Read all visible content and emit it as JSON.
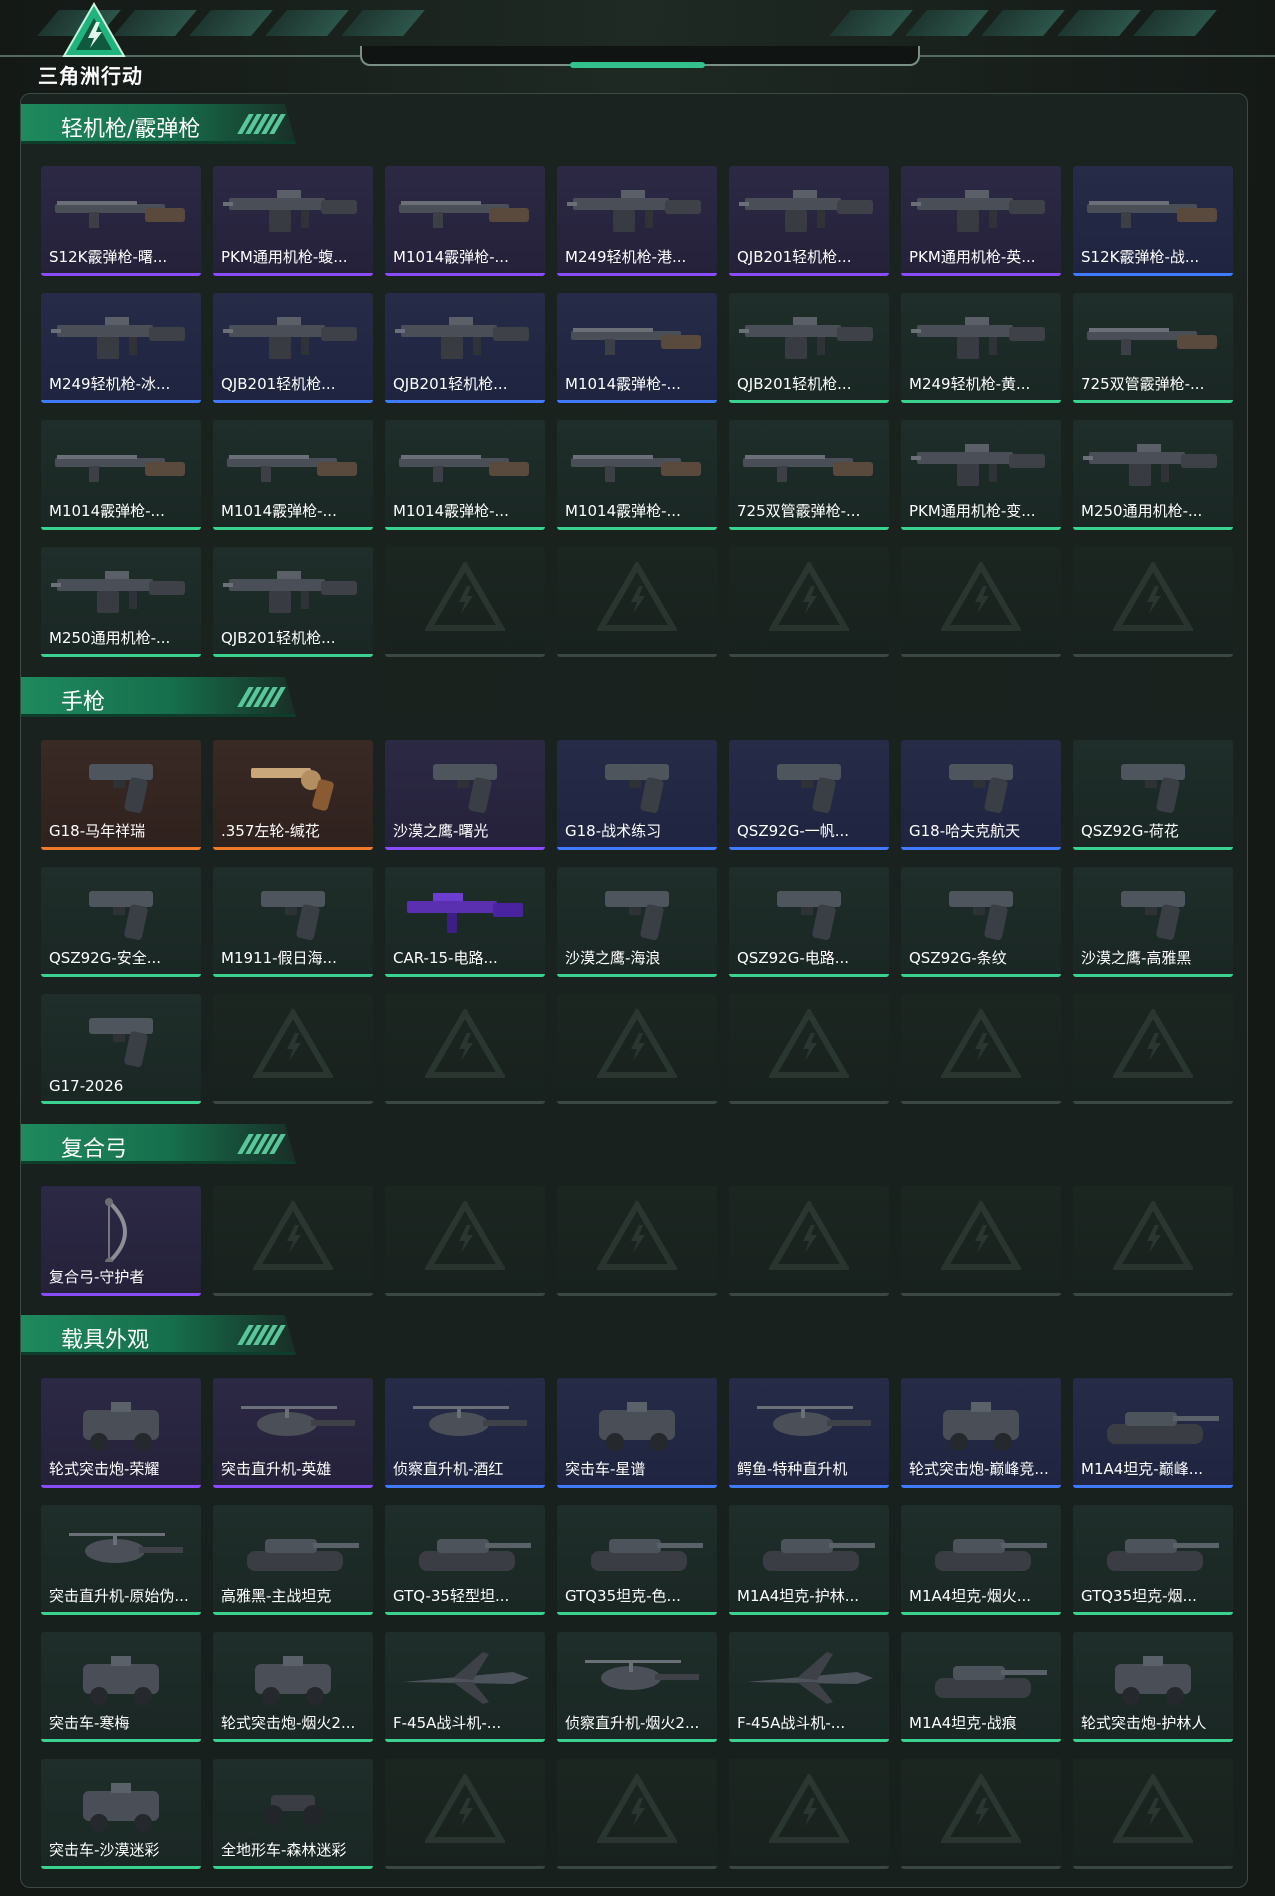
{
  "app": {
    "logo_text": "三角洲行动",
    "colors": {
      "background": "#151b18",
      "accent_green": "#33c28e",
      "section_header_green": "#1e8a5e",
      "rarity_epic": "#8a4bff",
      "rarity_rare": "#3f7aff",
      "rarity_uncommon": "#39d28f",
      "rarity_legendary": "#f07b2a",
      "empty_slot": "#3b4742"
    }
  },
  "sections": [
    {
      "title": "轻机枪/霰弹枪",
      "items": [
        {
          "label": "S12K霰弹枪-曙...",
          "rarity": "epic",
          "icon": "shotgun-icon"
        },
        {
          "label": "PKM通用机枪-蝮...",
          "rarity": "epic",
          "icon": "machine-gun-icon"
        },
        {
          "label": "M1014霰弹枪-...",
          "rarity": "epic",
          "icon": "shotgun-icon"
        },
        {
          "label": "M249轻机枪-港...",
          "rarity": "epic",
          "icon": "machine-gun-icon"
        },
        {
          "label": "QJB201轻机枪...",
          "rarity": "epic",
          "icon": "machine-gun-icon"
        },
        {
          "label": "PKM通用机枪-英...",
          "rarity": "epic",
          "icon": "machine-gun-icon"
        },
        {
          "label": "S12K霰弹枪-战...",
          "rarity": "rare",
          "icon": "shotgun-icon"
        },
        {
          "label": "M249轻机枪-冰...",
          "rarity": "rare",
          "icon": "machine-gun-icon"
        },
        {
          "label": "QJB201轻机枪...",
          "rarity": "rare",
          "icon": "machine-gun-icon"
        },
        {
          "label": "QJB201轻机枪...",
          "rarity": "rare",
          "icon": "machine-gun-icon"
        },
        {
          "label": "M1014霰弹枪-...",
          "rarity": "rare",
          "icon": "shotgun-icon"
        },
        {
          "label": "QJB201轻机枪...",
          "rarity": "uncommon",
          "icon": "machine-gun-icon"
        },
        {
          "label": "M249轻机枪-黄...",
          "rarity": "uncommon",
          "icon": "machine-gun-icon"
        },
        {
          "label": "725双管霰弹枪-...",
          "rarity": "uncommon",
          "icon": "shotgun-icon"
        },
        {
          "label": "M1014霰弹枪-...",
          "rarity": "uncommon",
          "icon": "shotgun-icon"
        },
        {
          "label": "M1014霰弹枪-...",
          "rarity": "uncommon",
          "icon": "shotgun-icon"
        },
        {
          "label": "M1014霰弹枪-...",
          "rarity": "uncommon",
          "icon": "shotgun-icon"
        },
        {
          "label": "M1014霰弹枪-...",
          "rarity": "uncommon",
          "icon": "shotgun-icon"
        },
        {
          "label": "725双管霰弹枪-...",
          "rarity": "uncommon",
          "icon": "shotgun-icon"
        },
        {
          "label": "PKM通用机枪-变...",
          "rarity": "uncommon",
          "icon": "machine-gun-icon"
        },
        {
          "label": "M250通用机枪-...",
          "rarity": "uncommon",
          "icon": "machine-gun-icon"
        },
        {
          "label": "M250通用机枪-...",
          "rarity": "uncommon",
          "icon": "machine-gun-icon"
        },
        {
          "label": "QJB201轻机枪...",
          "rarity": "uncommon",
          "icon": "machine-gun-icon"
        }
      ],
      "empty_slots": 5
    },
    {
      "title": "手枪",
      "items": [
        {
          "label": "G18-马年祥瑞",
          "rarity": "legend",
          "icon": "pistol-icon"
        },
        {
          "label": ".357左轮-缄花",
          "rarity": "legend",
          "icon": "revolver-icon"
        },
        {
          "label": "沙漠之鹰-曙光",
          "rarity": "epic",
          "icon": "pistol-icon"
        },
        {
          "label": "G18-战术练习",
          "rarity": "rare",
          "icon": "pistol-icon"
        },
        {
          "label": "QSZ92G-一帆...",
          "rarity": "rare",
          "icon": "pistol-icon"
        },
        {
          "label": "G18-哈夫克航天",
          "rarity": "rare",
          "icon": "pistol-icon"
        },
        {
          "label": "QSZ92G-荷花",
          "rarity": "uncommon",
          "icon": "pistol-icon"
        },
        {
          "label": "QSZ92G-安全...",
          "rarity": "uncommon",
          "icon": "pistol-icon"
        },
        {
          "label": "M1911-假日海...",
          "rarity": "uncommon",
          "icon": "pistol-icon"
        },
        {
          "label": "CAR-15-电路...",
          "rarity": "uncommon",
          "icon": "rifle-icon"
        },
        {
          "label": "沙漠之鹰-海浪",
          "rarity": "uncommon",
          "icon": "pistol-icon"
        },
        {
          "label": "QSZ92G-电路...",
          "rarity": "uncommon",
          "icon": "pistol-icon"
        },
        {
          "label": "QSZ92G-条纹",
          "rarity": "uncommon",
          "icon": "pistol-icon"
        },
        {
          "label": "沙漠之鹰-高雅黑",
          "rarity": "uncommon",
          "icon": "pistol-icon"
        },
        {
          "label": "G17-2026",
          "rarity": "uncommon",
          "icon": "pistol-icon"
        }
      ],
      "empty_slots": 6
    },
    {
      "title": "复合弓",
      "items": [
        {
          "label": "复合弓-守护者",
          "rarity": "epic",
          "icon": "bow-icon"
        }
      ],
      "empty_slots": 6
    },
    {
      "title": "载具外观",
      "items": [
        {
          "label": "轮式突击炮-荣耀",
          "rarity": "epic",
          "icon": "armored-car-icon"
        },
        {
          "label": "突击直升机-英雄",
          "rarity": "epic",
          "icon": "helicopter-icon"
        },
        {
          "label": "侦察直升机-酒红",
          "rarity": "rare",
          "icon": "helicopter-icon"
        },
        {
          "label": "突击车-星谱",
          "rarity": "rare",
          "icon": "armored-car-icon"
        },
        {
          "label": "鳄鱼-特种直升机",
          "rarity": "rare",
          "icon": "helicopter-icon"
        },
        {
          "label": "轮式突击炮-巅峰竞...",
          "rarity": "rare",
          "icon": "armored-car-icon"
        },
        {
          "label": "M1A4坦克-巅峰...",
          "rarity": "rare",
          "icon": "tank-icon"
        },
        {
          "label": "突击直升机-原始伪...",
          "rarity": "uncommon",
          "icon": "helicopter-icon"
        },
        {
          "label": "高雅黑-主战坦克",
          "rarity": "uncommon",
          "icon": "tank-icon"
        },
        {
          "label": "GTQ-35轻型坦...",
          "rarity": "uncommon",
          "icon": "tank-icon"
        },
        {
          "label": "GTQ35坦克-色...",
          "rarity": "uncommon",
          "icon": "tank-icon"
        },
        {
          "label": "M1A4坦克-护林...",
          "rarity": "uncommon",
          "icon": "tank-icon"
        },
        {
          "label": "M1A4坦克-烟火...",
          "rarity": "uncommon",
          "icon": "tank-icon"
        },
        {
          "label": "GTQ35坦克-烟...",
          "rarity": "uncommon",
          "icon": "tank-icon"
        },
        {
          "label": "突击车-寒梅",
          "rarity": "uncommon",
          "icon": "armored-car-icon"
        },
        {
          "label": "轮式突击炮-烟火2...",
          "rarity": "uncommon",
          "icon": "armored-car-icon"
        },
        {
          "label": "F-45A战斗机-...",
          "rarity": "uncommon",
          "icon": "jet-icon"
        },
        {
          "label": "侦察直升机-烟火2...",
          "rarity": "uncommon",
          "icon": "helicopter-icon"
        },
        {
          "label": "F-45A战斗机-...",
          "rarity": "uncommon",
          "icon": "jet-icon"
        },
        {
          "label": "M1A4坦克-战痕",
          "rarity": "uncommon",
          "icon": "tank-icon"
        },
        {
          "label": "轮式突击炮-护林人",
          "rarity": "uncommon",
          "icon": "armored-car-icon"
        },
        {
          "label": "突击车-沙漠迷彩",
          "rarity": "uncommon",
          "icon": "armored-car-icon"
        },
        {
          "label": "全地形车-森林迷彩",
          "rarity": "uncommon",
          "icon": "atv-icon"
        }
      ],
      "empty_slots": 5
    }
  ]
}
